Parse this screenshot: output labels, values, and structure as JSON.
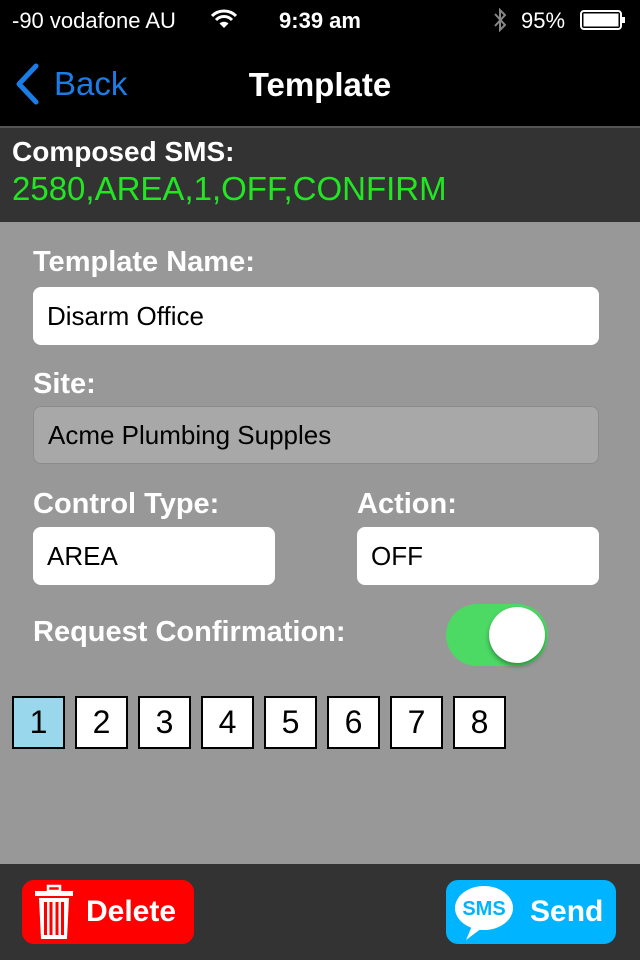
{
  "status_bar": {
    "carrier": "-90 vodafone AU",
    "time": "9:39 am",
    "battery_percent": "95%",
    "battery_level": 0.95
  },
  "nav": {
    "back_label": "Back",
    "title": "Template"
  },
  "composed_sms": {
    "label": "Composed SMS:",
    "value": "2580,AREA,1,OFF,CONFIRM",
    "value_color": "#22e622"
  },
  "form": {
    "template_name": {
      "label": "Template Name:",
      "value": "Disarm Office"
    },
    "site": {
      "label": "Site:",
      "value": "Acme Plumbing Supples"
    },
    "control_type": {
      "label": "Control Type:",
      "value": "AREA"
    },
    "action": {
      "label": "Action:",
      "value": "OFF"
    },
    "request_confirmation": {
      "label": "Request Confirmation:",
      "enabled": true
    }
  },
  "areas": {
    "items": [
      "1",
      "2",
      "3",
      "4",
      "5",
      "6",
      "7",
      "8"
    ],
    "selected": "1"
  },
  "actions": {
    "delete_label": "Delete",
    "send_label": "Send",
    "sms_icon_text": "SMS",
    "delete_color": "#ff0000",
    "send_color": "#00b4ff"
  }
}
